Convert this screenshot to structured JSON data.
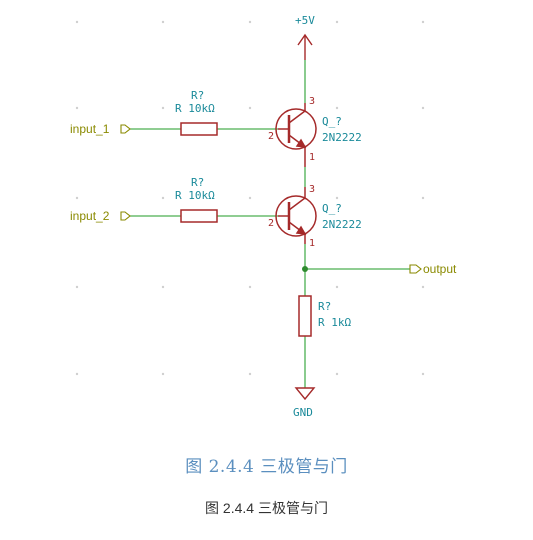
{
  "colors": {
    "wire": "#4caf50",
    "component": "#a52a2a",
    "label": "#1a8a9a",
    "port": "#8a8a00",
    "power": "#a52a2a",
    "grid_dot": "#cfcfcf",
    "junction": "#2e8b2e"
  },
  "schematic": {
    "power_label": "+5V",
    "gnd_label": "GND",
    "input1": "input_1",
    "input2": "input_2",
    "output": "output",
    "r1": {
      "ref": "R?",
      "value": "R 10kΩ"
    },
    "r2": {
      "ref": "R?",
      "value": "R 10kΩ"
    },
    "r3": {
      "ref": "R?",
      "value": "R 1kΩ"
    },
    "q1": {
      "ref": "Q_?",
      "value": "2N2222",
      "pin_c": "3",
      "pin_b": "2",
      "pin_e": "1"
    },
    "q2": {
      "ref": "Q_?",
      "value": "2N2222",
      "pin_c": "3",
      "pin_b": "2",
      "pin_e": "1"
    }
  },
  "caption_main": "图 2.4.4 三极管与门",
  "caption_sub": "图 2.4.4 三极管与门"
}
